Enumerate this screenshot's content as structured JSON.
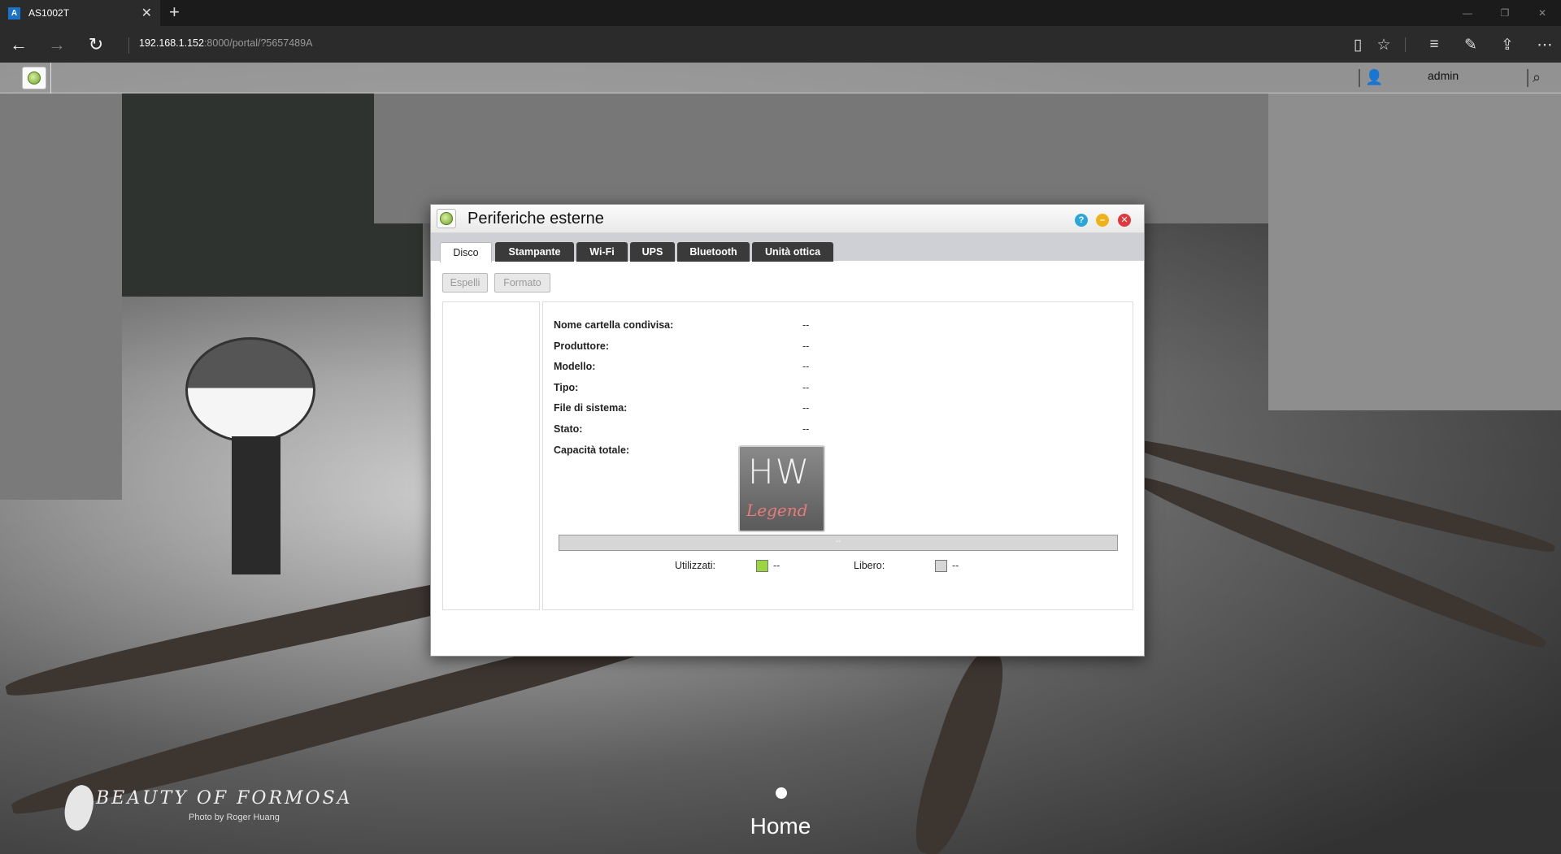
{
  "browser": {
    "tab_title": "AS1002T",
    "tab_favicon": "asustor-icon",
    "url_host": "192.168.1.152",
    "url_rest": ":8000/portal/?5657489A"
  },
  "adm_bar": {
    "user_name": "admin"
  },
  "dialog": {
    "title": "Periferiche esterne",
    "tabs": [
      {
        "label": "Disco",
        "active": true
      },
      {
        "label": "Stampante",
        "active": false
      },
      {
        "label": "Wi-Fi",
        "active": false
      },
      {
        "label": "UPS",
        "active": false
      },
      {
        "label": "Bluetooth",
        "active": false
      },
      {
        "label": "Unità ottica",
        "active": false
      }
    ],
    "actions": {
      "eject": "Espelli",
      "format": "Formato"
    },
    "info": [
      {
        "label": "Nome cartella condivisa:",
        "value": "--"
      },
      {
        "label": "Produttore:",
        "value": "--"
      },
      {
        "label": "Modello:",
        "value": "--"
      },
      {
        "label": "Tipo:",
        "value": "--"
      },
      {
        "label": "File di sistema:",
        "value": "--"
      },
      {
        "label": "Stato:",
        "value": "--"
      },
      {
        "label": "Capacità totale:",
        "value": ""
      }
    ],
    "capacity": {
      "bar_text": "--",
      "used_fraction": 0,
      "used_label": "Utilizzati:",
      "used_value": "--",
      "used_color": "#9bd640",
      "free_label": "Libero:",
      "free_value": "--",
      "free_color": "#d6d6d6"
    }
  },
  "watermark": {
    "logo_text": "HW",
    "logo_sub": "Legend"
  },
  "wallpaper": {
    "title": "BEAUTY OF FORMOSA",
    "credit": "Photo by Roger Huang"
  },
  "desktop": {
    "page_label": "Home"
  }
}
